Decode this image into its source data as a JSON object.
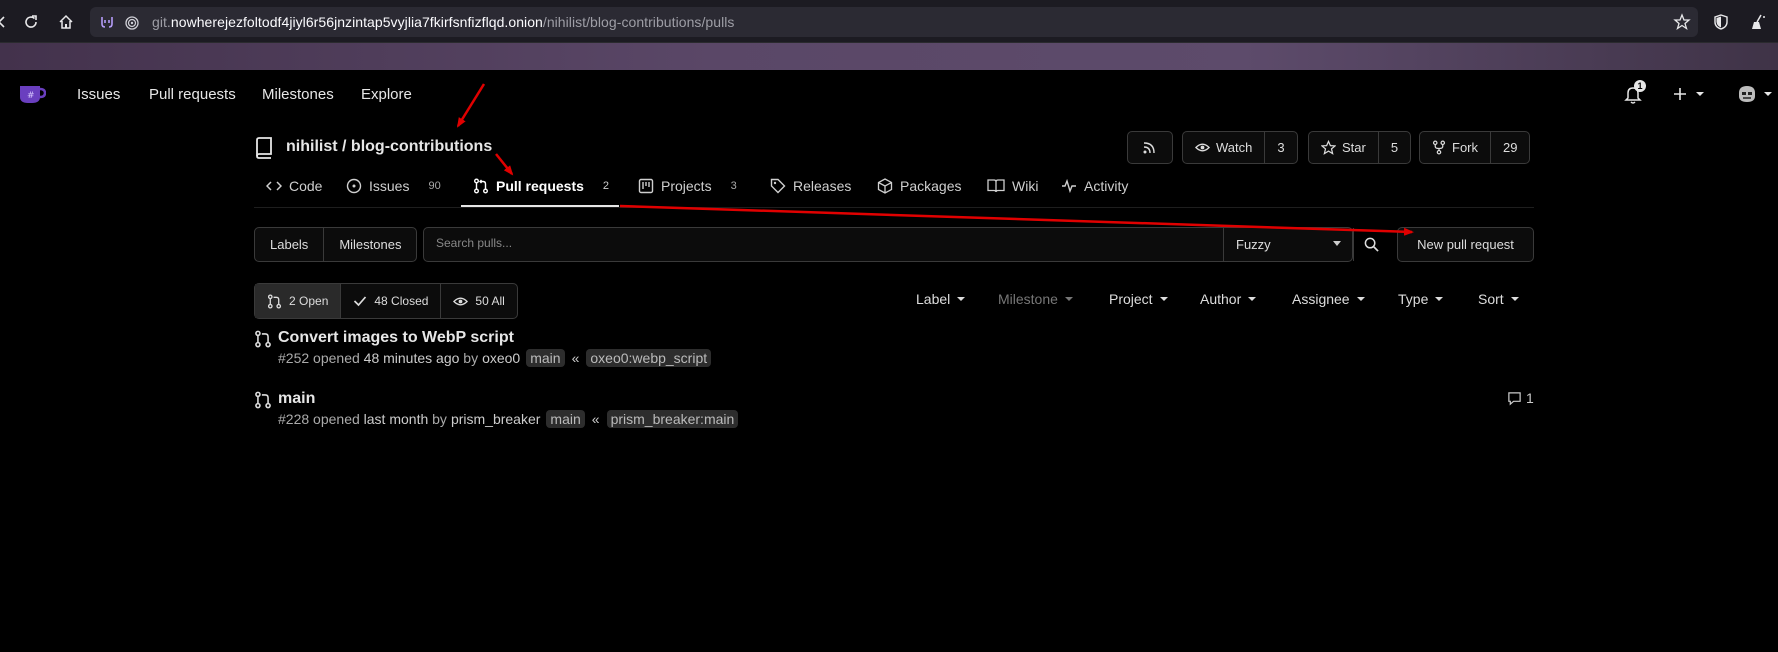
{
  "browser": {
    "url_prefix": "git.",
    "url_host": "nowherejezfoltodf4jiyl6r56jnzintap5vyjlia7fkirfsnfizflqd.onion",
    "url_path": "/nihilist/blog-contributions/pulls"
  },
  "nav": {
    "items": [
      "Issues",
      "Pull requests",
      "Milestones",
      "Explore"
    ],
    "notification_count": "1"
  },
  "repo": {
    "owner": "nihilist",
    "separator": "/",
    "name": "blog-contributions",
    "watch_label": "Watch",
    "watch_count": "3",
    "star_label": "Star",
    "star_count": "5",
    "fork_label": "Fork",
    "fork_count": "29"
  },
  "tabs": [
    {
      "label": "Code",
      "count": ""
    },
    {
      "label": "Issues",
      "count": "90"
    },
    {
      "label": "Pull requests",
      "count": "2"
    },
    {
      "label": "Projects",
      "count": "3"
    },
    {
      "label": "Releases",
      "count": ""
    },
    {
      "label": "Packages",
      "count": ""
    },
    {
      "label": "Wiki",
      "count": ""
    },
    {
      "label": "Activity",
      "count": ""
    }
  ],
  "filters": {
    "labels_btn": "Labels",
    "milestones_btn": "Milestones",
    "search_placeholder": "Search pulls...",
    "fuzzy": "Fuzzy",
    "new_pr": "New pull request",
    "states": [
      "2 Open",
      "48 Closed",
      "50 All"
    ],
    "dropdowns": [
      "Label",
      "Milestone",
      "Project",
      "Author",
      "Assignee",
      "Type",
      "Sort"
    ]
  },
  "pulls": [
    {
      "title": "Convert images to WebP script",
      "number": "#252",
      "opened": "opened",
      "time": "48 minutes ago",
      "by": "by",
      "author": "oxeo0",
      "target": "main",
      "arrow": "«",
      "source": "oxeo0:webp_script",
      "comments": ""
    },
    {
      "title": "main",
      "number": "#228",
      "opened": "opened",
      "time": "last month",
      "by": "by",
      "author": "prism_breaker",
      "target": "main",
      "arrow": "«",
      "source": "prism_breaker:main",
      "comments": "1"
    }
  ],
  "colors": {
    "annotation_arrow": "#e00000",
    "background": "#000000",
    "border": "#3a3a3a"
  }
}
